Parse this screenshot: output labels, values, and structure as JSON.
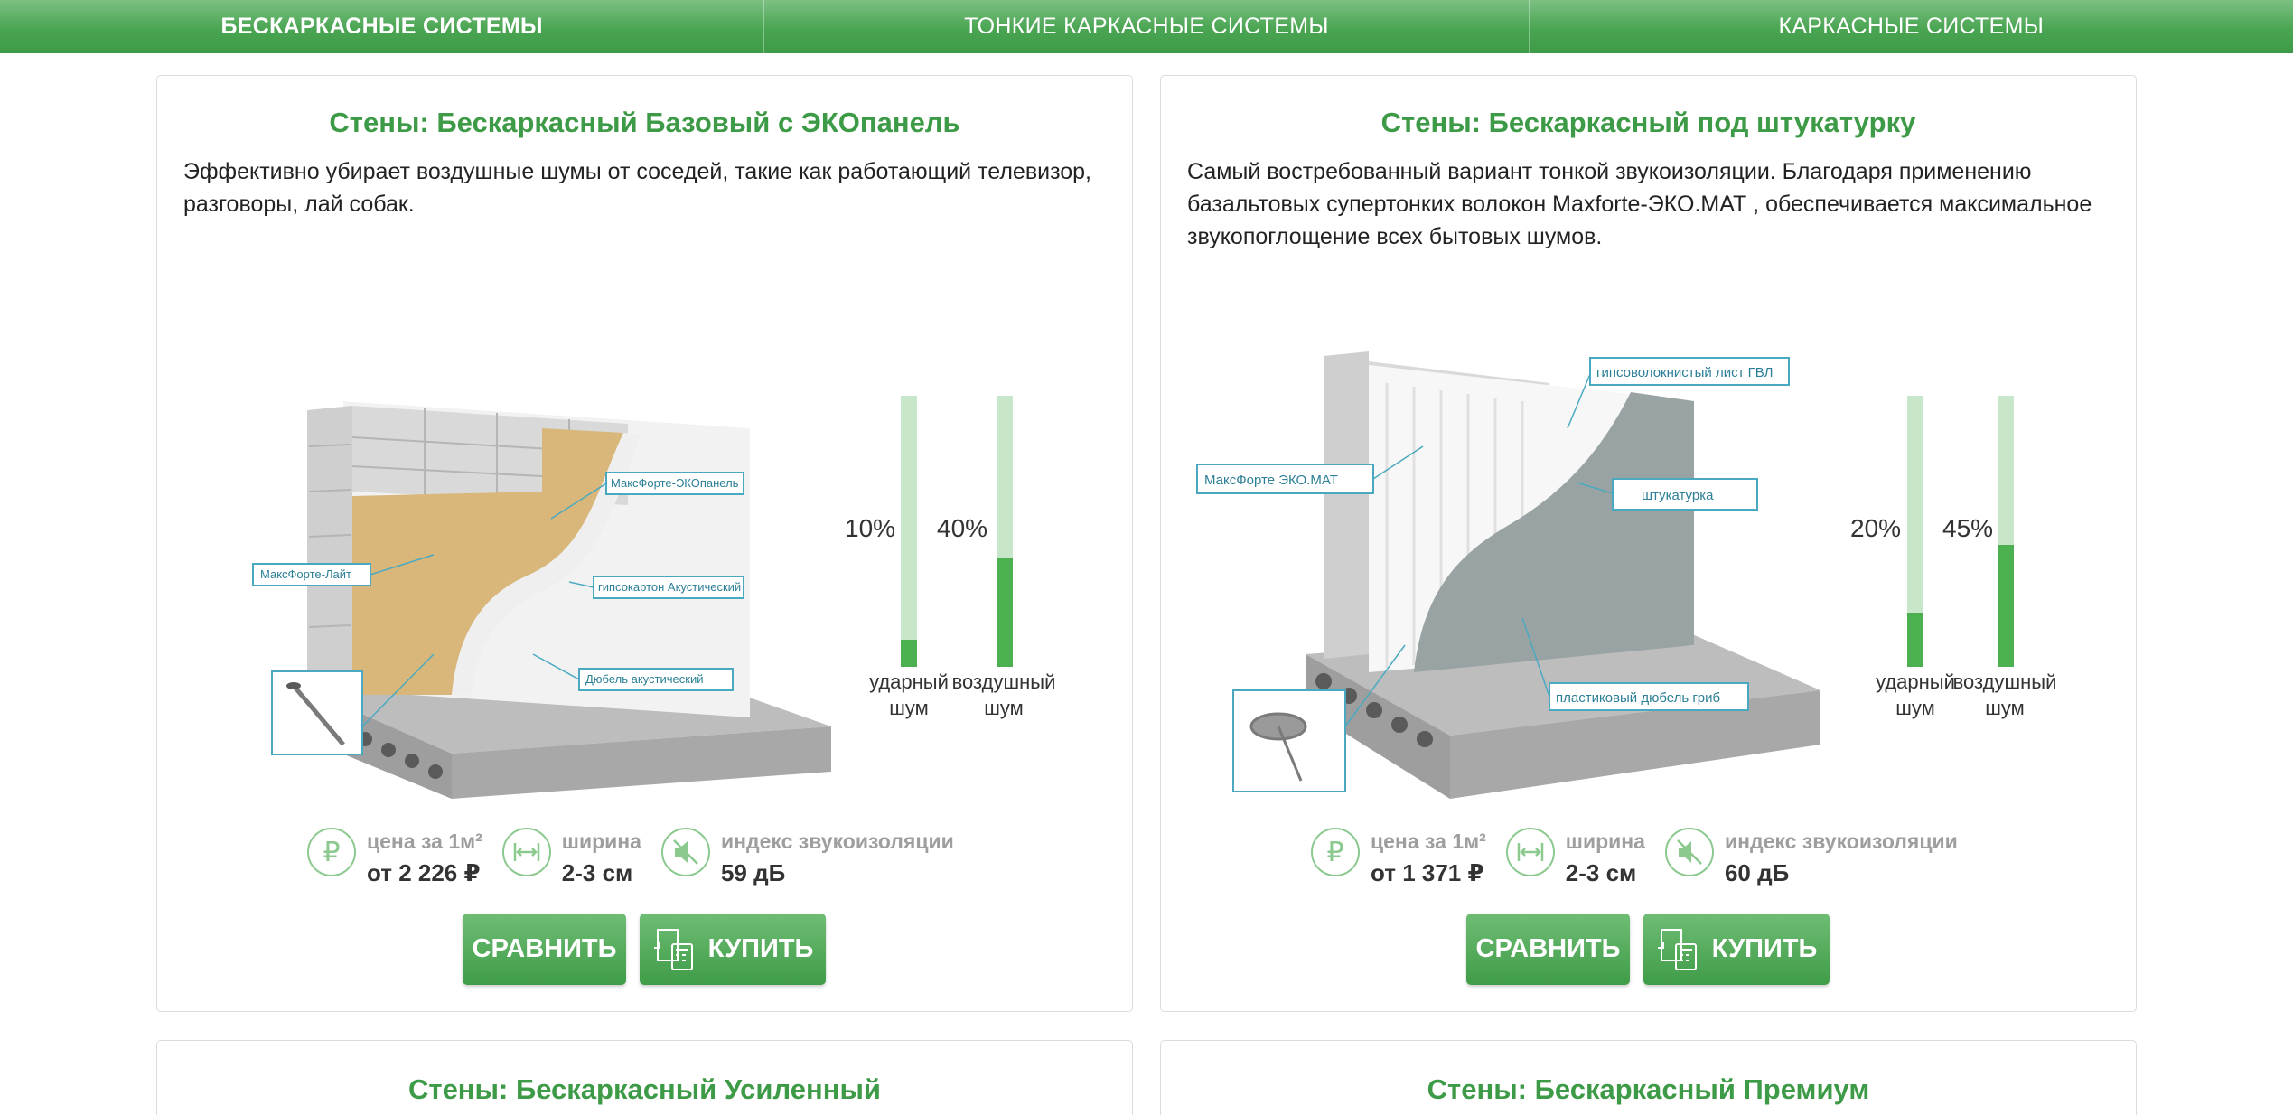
{
  "nav": {
    "tabs": [
      {
        "label": "БЕСКАРКАСНЫЕ СИСТЕМЫ",
        "active": true
      },
      {
        "label": "ТОНКИЕ КАРКАСНЫЕ СИСТЕМЫ",
        "active": false
      },
      {
        "label": "КАРКАСНЫЕ СИСТЕМЫ",
        "active": false
      }
    ]
  },
  "colors": {
    "accent": "#3d9a46",
    "bar_fill": "#4caf50",
    "bar_track": "#c8e6c9",
    "muted": "#9e9e9e"
  },
  "cards": [
    {
      "title": "Стены: Бескаркасный Базовый с ЭКОпанель",
      "description": "Эффективно убирает воздушные шумы от соседей, такие как работающий телевизор, разговоры, лай собак.",
      "callouts": [
        "МаксФорте-ЭКОпанель",
        "МаксФорте-Лайт",
        "гипсокартон Акустический",
        "Дюбель акустический"
      ],
      "noise": [
        {
          "pct_text": "10%",
          "value": 10,
          "label_line1": "ударный",
          "label_line2": "шум"
        },
        {
          "pct_text": "40%",
          "value": 40,
          "label_line1": "воздушный",
          "label_line2": "шум"
        }
      ],
      "specs": [
        {
          "icon": "ruble-icon",
          "label": "цена за 1м²",
          "value": "от 2 226 ₽"
        },
        {
          "icon": "width-icon",
          "label": "ширина",
          "value": "2-3 см"
        },
        {
          "icon": "sound-off-icon",
          "label": "индекс звукоизоляции",
          "value": "59 дБ"
        }
      ],
      "compare_label": "СРАВНИТЬ",
      "buy_label": "КУПИТЬ"
    },
    {
      "title": "Стены: Бескаркасный под штукатурку",
      "description": "Самый востребованный вариант тонкой звукоизоляции. Благодаря применению базальтовых супертонких волокон Maxforte-ЭКО.МАТ , обеспечивается максимальное звукопоглощение всех бытовых шумов.",
      "callouts": [
        "гипсоволокнистый лист ГВЛ",
        "МаксФорте ЭКО.МАТ",
        "штукатурка",
        "пластиковый дюбель гриб"
      ],
      "noise": [
        {
          "pct_text": "20%",
          "value": 20,
          "label_line1": "ударный",
          "label_line2": "шум"
        },
        {
          "pct_text": "45%",
          "value": 45,
          "label_line1": "воздушный",
          "label_line2": "шум"
        }
      ],
      "specs": [
        {
          "icon": "ruble-icon",
          "label": "цена за 1м²",
          "value": "от 1 371 ₽"
        },
        {
          "icon": "width-icon",
          "label": "ширина",
          "value": "2-3 см"
        },
        {
          "icon": "sound-off-icon",
          "label": "индекс звукоизоляции",
          "value": "60 дБ"
        }
      ],
      "compare_label": "СРАВНИТЬ",
      "buy_label": "КУПИТЬ"
    },
    {
      "title": "Стены: Бескаркасный Усиленный"
    },
    {
      "title": "Стены: Бескаркасный Премиум"
    }
  ]
}
